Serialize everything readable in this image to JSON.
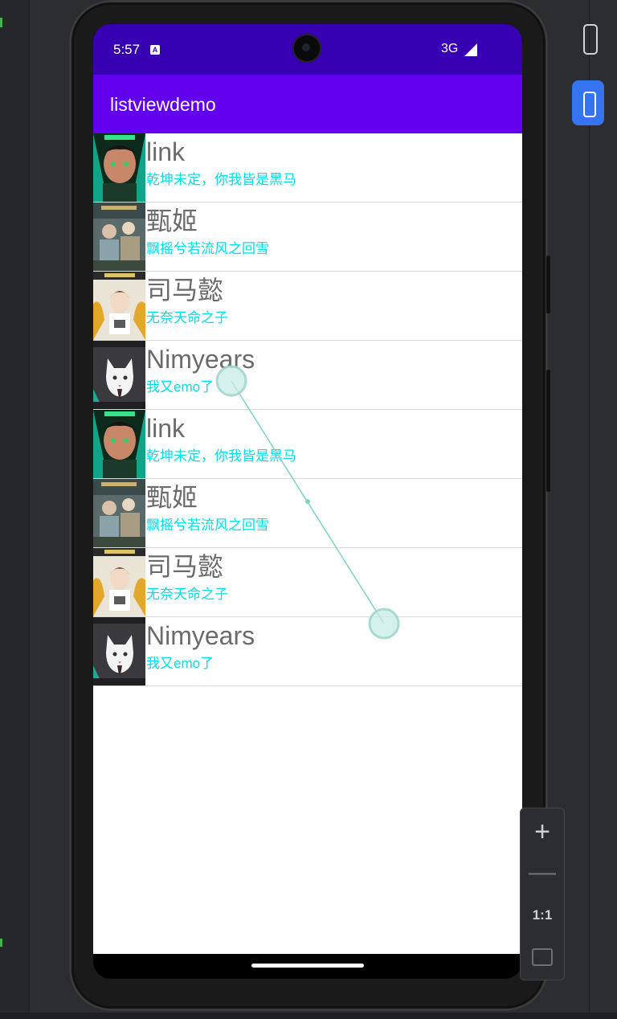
{
  "status_bar": {
    "time": "5:57",
    "notification_icon": "a-badge-icon",
    "network": "3G",
    "signal_icon": "signal-icon"
  },
  "app_bar": {
    "title": "listviewdemo"
  },
  "list": {
    "items": [
      {
        "title": "link",
        "subtitle": "乾坤未定，你我皆是黑马",
        "avatar": "anime-boy-avatar"
      },
      {
        "title": "甄姬",
        "subtitle": "飘摇兮若流风之回雪",
        "avatar": "figurines-avatar"
      },
      {
        "title": "司马懿",
        "subtitle": "无奈天命之子",
        "avatar": "anime-girl-avatar"
      },
      {
        "title": "Nimyears",
        "subtitle": "我又emo了",
        "avatar": "white-cat-avatar"
      },
      {
        "title": "link",
        "subtitle": "乾坤未定，你我皆是黑马",
        "avatar": "anime-boy-avatar"
      },
      {
        "title": "甄姬",
        "subtitle": "飘摇兮若流风之回雪",
        "avatar": "figurines-avatar"
      },
      {
        "title": "司马懿",
        "subtitle": "无奈天命之子",
        "avatar": "anime-girl-avatar"
      },
      {
        "title": "Nimyears",
        "subtitle": "我又emo了",
        "avatar": "white-cat-avatar"
      }
    ]
  },
  "zoom_controls": {
    "zoom_in": "+",
    "zoom_out": "—",
    "actual_size": "1:1",
    "fit_icon": "fit-screen-icon"
  },
  "colors": {
    "status_bar": "#3700b3",
    "app_bar": "#6200ee",
    "title_text": "#6b6b6b",
    "subtitle_text": "#00e0e6"
  }
}
